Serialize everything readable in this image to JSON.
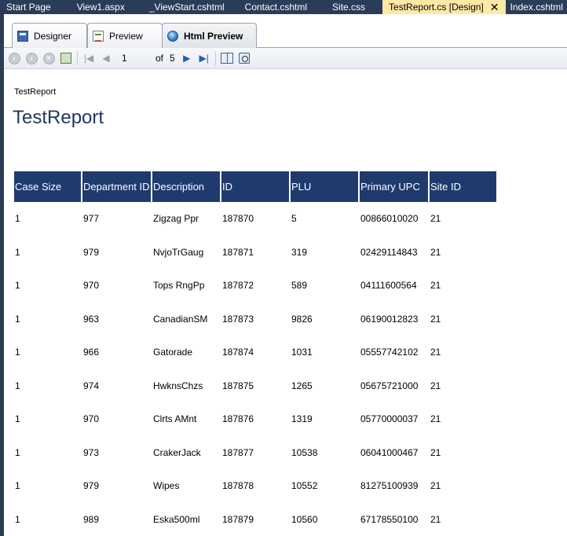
{
  "doc_tabs": [
    {
      "label": "Start Page"
    },
    {
      "label": "View1.aspx"
    },
    {
      "label": "_ViewStart.cshtml"
    },
    {
      "label": "Contact.cshtml"
    },
    {
      "label": "Site.css"
    },
    {
      "label": "TestReport.cs [Design]",
      "active": true
    },
    {
      "label": "Index.cshtml"
    }
  ],
  "view_tabs": {
    "designer": "Designer",
    "preview": "Preview",
    "html_preview": "Html Preview"
  },
  "toolbar": {
    "current_page": "1",
    "of_label": "of",
    "total_pages": "5"
  },
  "report": {
    "small_title": "TestReport",
    "title": "TestReport",
    "columns": [
      "Case Size",
      "Department ID",
      "Description",
      "ID",
      "PLU",
      "Primary UPC",
      "Site ID"
    ],
    "rows": [
      [
        "1",
        "977",
        "Zigzag Ppr",
        "187870",
        "5",
        "00866010020",
        "21"
      ],
      [
        "1",
        "979",
        "NvjoTrGaug",
        "187871",
        "319",
        "02429114843",
        "21"
      ],
      [
        "1",
        "970",
        "Tops RngPp",
        "187872",
        "589",
        "04111600564",
        "21"
      ],
      [
        "1",
        "963",
        "CanadianSM",
        "187873",
        "9826",
        "06190012823",
        "21"
      ],
      [
        "1",
        "966",
        "Gatorade",
        "187874",
        "1031",
        "05557742102",
        "21"
      ],
      [
        "1",
        "974",
        "HwknsChzs",
        "187875",
        "1265",
        "05675721000",
        "21"
      ],
      [
        "1",
        "970",
        "Clrts AMnt",
        "187876",
        "1319",
        "05770000037",
        "21"
      ],
      [
        "1",
        "973",
        "CrakerJack",
        "187877",
        "10538",
        "06041000467",
        "21"
      ],
      [
        "1",
        "979",
        "Wipes",
        "187878",
        "10552",
        "81275100939",
        "21"
      ],
      [
        "1",
        "989",
        "Eska500ml",
        "187879",
        "10560",
        "67178550100",
        "21"
      ]
    ]
  },
  "colors": {
    "ide_background": "#2b3c59",
    "active_tab": "#ffe8a6",
    "header_fill": "#1f3b6e",
    "title_color": "#1f3864"
  }
}
